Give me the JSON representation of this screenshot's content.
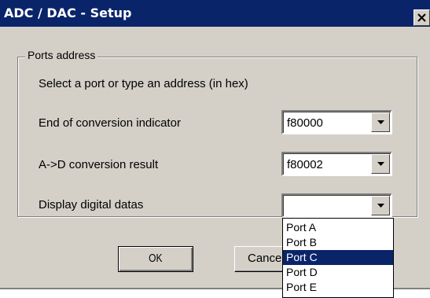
{
  "window": {
    "title": "ADC / DAC  - Setup",
    "close_icon": "close-x-icon"
  },
  "group": {
    "legend": "Ports address",
    "instruction": "Select a port or type an address (in hex)"
  },
  "fields": [
    {
      "label": "End of conversion indicator",
      "value": "f80000"
    },
    {
      "label": "A->D conversion result",
      "value": "f80002"
    },
    {
      "label": "Display digital datas",
      "value": ""
    }
  ],
  "dropdown": {
    "options": [
      "Port A",
      "Port B",
      "Port C",
      "Port D",
      "Port E"
    ],
    "selected_index": 2
  },
  "buttons": {
    "ok_label": "OK",
    "cancel_label": "Cancel"
  },
  "colors": {
    "titlebar": "#0a246a",
    "selection": "#0a246a",
    "face": "#d4d0c8"
  }
}
